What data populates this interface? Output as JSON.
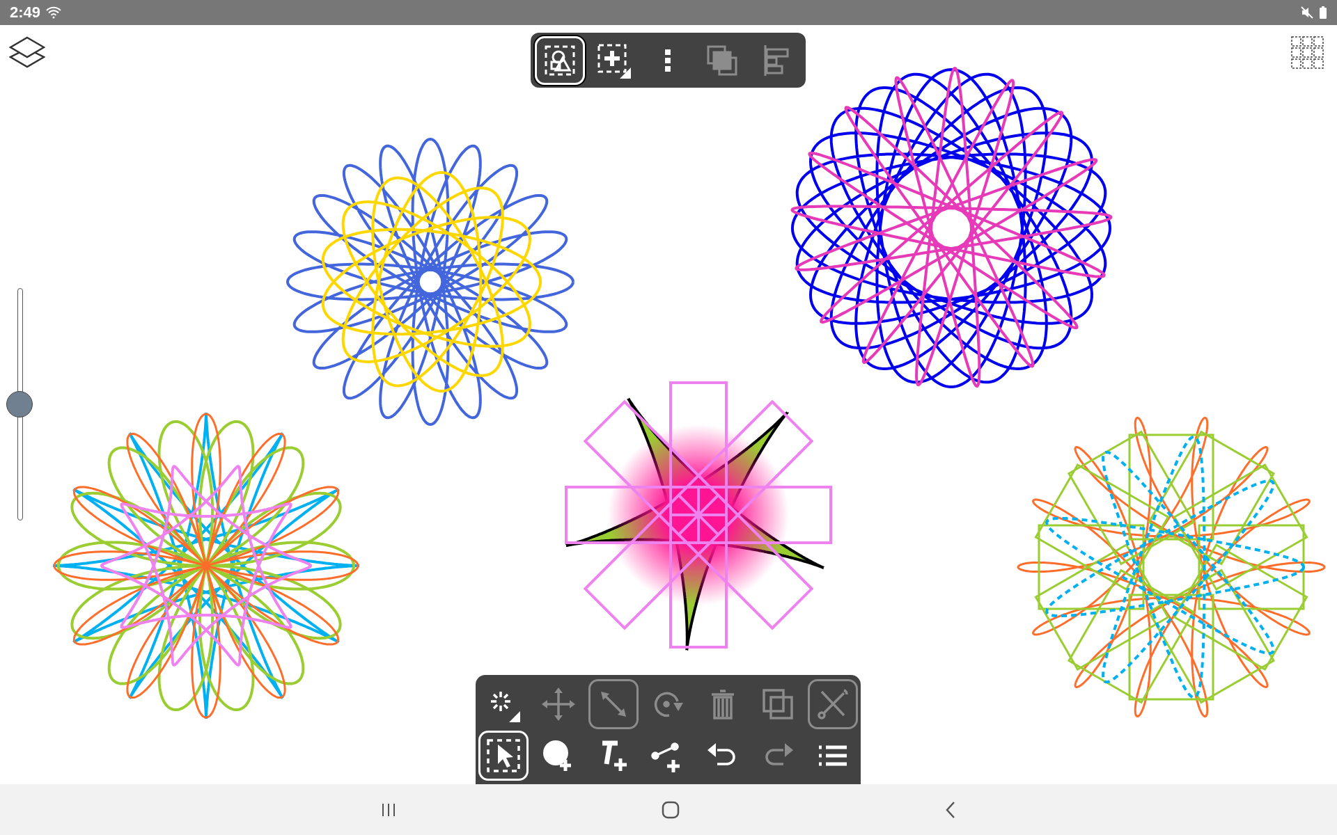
{
  "status_bar": {
    "time": "2:49"
  },
  "top_toolbar": [
    {
      "kind": "shape-select",
      "selected": true,
      "disabled": false
    },
    {
      "kind": "add-selection",
      "selected": false,
      "disabled": false
    },
    {
      "kind": "more",
      "selected": false,
      "disabled": false
    },
    {
      "kind": "arrange",
      "selected": false,
      "disabled": true
    },
    {
      "kind": "align",
      "selected": false,
      "disabled": true
    }
  ],
  "zoom_slider": {
    "level": 0.5
  },
  "bottom_toolbar": [
    [
      {
        "kind": "effects",
        "selected": false,
        "disabled": false
      },
      {
        "kind": "move",
        "selected": false,
        "disabled": true
      },
      {
        "kind": "resize",
        "selected": true,
        "disabled": true
      },
      {
        "kind": "rotate",
        "selected": false,
        "disabled": true
      },
      {
        "kind": "delete",
        "selected": false,
        "disabled": true
      },
      {
        "kind": "duplicate",
        "selected": false,
        "disabled": true
      },
      {
        "kind": "tools",
        "selected": true,
        "disabled": true
      }
    ],
    [
      {
        "kind": "select",
        "selected": true,
        "disabled": false
      },
      {
        "kind": "add-shape",
        "selected": false,
        "disabled": false
      },
      {
        "kind": "add-text",
        "selected": false,
        "disabled": false
      },
      {
        "kind": "add-line",
        "selected": false,
        "disabled": false
      },
      {
        "kind": "undo",
        "selected": false,
        "disabled": false
      },
      {
        "kind": "redo",
        "selected": false,
        "disabled": true
      },
      {
        "kind": "list",
        "selected": false,
        "disabled": false
      }
    ]
  ]
}
